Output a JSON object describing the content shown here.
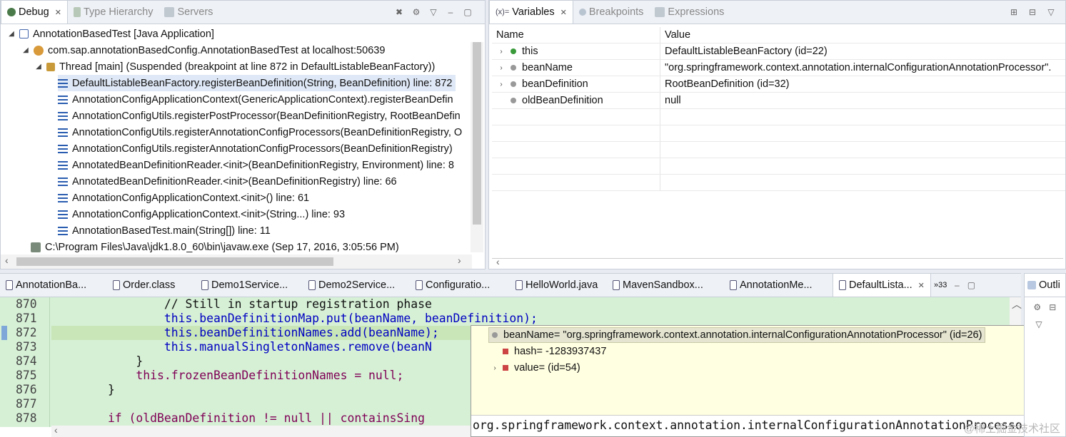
{
  "debug": {
    "tabs": [
      {
        "label": "Debug",
        "active": true
      },
      {
        "label": "Type Hierarchy",
        "active": false
      },
      {
        "label": "Servers",
        "active": false
      }
    ],
    "tree": {
      "app": "AnnotationBasedTest [Java Application]",
      "vm": "com.sap.annotationBasedConfig.AnnotationBasedTest at localhost:50639",
      "thread": "Thread [main] (Suspended (breakpoint at line 872 in DefaultListableBeanFactory))",
      "frames": [
        "DefaultListableBeanFactory.registerBeanDefinition(String, BeanDefinition) line: 872",
        "AnnotationConfigApplicationContext(GenericApplicationContext).registerBeanDefin",
        "AnnotationConfigUtils.registerPostProcessor(BeanDefinitionRegistry, RootBeanDefin",
        "AnnotationConfigUtils.registerAnnotationConfigProcessors(BeanDefinitionRegistry, O",
        "AnnotationConfigUtils.registerAnnotationConfigProcessors(BeanDefinitionRegistry)",
        "AnnotatedBeanDefinitionReader.<init>(BeanDefinitionRegistry, Environment) line: 8",
        "AnnotatedBeanDefinitionReader.<init>(BeanDefinitionRegistry) line: 66",
        "AnnotationConfigApplicationContext.<init>() line: 61",
        "AnnotationConfigApplicationContext.<init>(String...) line: 93",
        "AnnotationBasedTest.main(String[]) line: 11"
      ],
      "process": "C:\\Program Files\\Java\\jdk1.8.0_60\\bin\\javaw.exe (Sep 17, 2016, 3:05:56 PM)"
    }
  },
  "variables": {
    "tabs": [
      {
        "label": "Variables",
        "active": true
      },
      {
        "label": "Breakpoints",
        "active": false
      },
      {
        "label": "Expressions",
        "active": false
      }
    ],
    "columns": {
      "name": "Name",
      "value": "Value"
    },
    "rows": [
      {
        "name": "this",
        "value": "DefaultListableBeanFactory  (id=22)",
        "dot": "#3a9a3a"
      },
      {
        "name": "beanName",
        "value": "\"org.springframework.context.annotation.internalConfigurationAnnotationProcessor\".",
        "dot": "#999999"
      },
      {
        "name": "beanDefinition",
        "value": "RootBeanDefinition  (id=32)",
        "dot": "#999999"
      },
      {
        "name": "oldBeanDefinition",
        "value": "null",
        "dot": "#999999"
      }
    ]
  },
  "editor": {
    "tabs": [
      {
        "label": "AnnotationBa..."
      },
      {
        "label": "Order.class"
      },
      {
        "label": "Demo1Service..."
      },
      {
        "label": "Demo2Service..."
      },
      {
        "label": "Configuratio..."
      },
      {
        "label": "HelloWorld.java"
      },
      {
        "label": "MavenSandbox..."
      },
      {
        "label": "AnnotationMe..."
      },
      {
        "label": "DefaultLista..."
      }
    ],
    "overflow": "»33",
    "lines": [
      {
        "num": "870",
        "code": "                // Still in startup registration phase"
      },
      {
        "num": "871",
        "code": "                this.beanDefinitionMap.put(beanName, beanDefinition);"
      },
      {
        "num": "872",
        "code": "                this.beanDefinitionNames.add(beanName);"
      },
      {
        "num": "873",
        "code": "                this.manualSingletonNames.remove(beanN"
      },
      {
        "num": "874",
        "code": "            }"
      },
      {
        "num": "875",
        "code": "            this.frozenBeanDefinitionNames = null;"
      },
      {
        "num": "876",
        "code": "        }"
      },
      {
        "num": "877",
        "code": ""
      },
      {
        "num": "878",
        "code": "        if (oldBeanDefinition != null || containsSing"
      }
    ]
  },
  "popup": {
    "root": "beanName= \"org.springframework.context.annotation.internalConfigurationAnnotationProcessor\" (id=26)",
    "children": [
      {
        "label": "hash= -1283937437"
      },
      {
        "label": "value= (id=54)"
      }
    ],
    "detail": "org.springframework.context.annotation.internalConfigurationAnnotationProcesso"
  },
  "outline": {
    "tab": "Outli"
  },
  "watermark": "@稀土掘金技术社区"
}
